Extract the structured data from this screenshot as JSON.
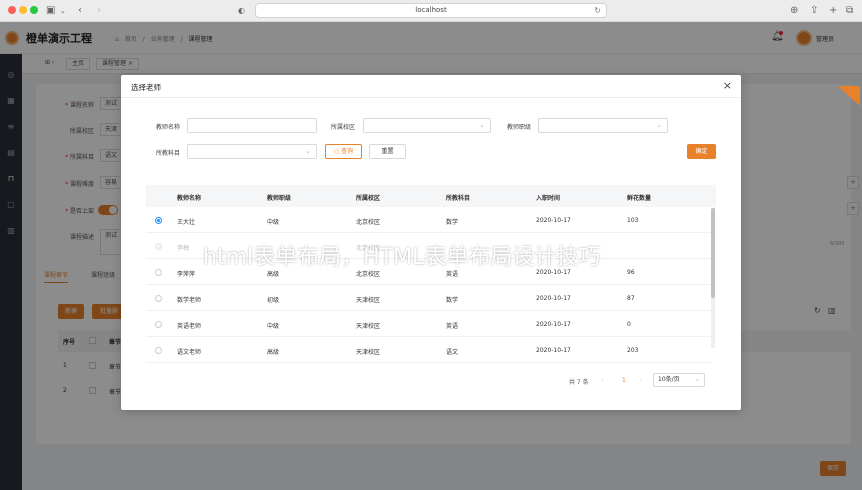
{
  "browser": {
    "url": "localhost"
  },
  "app": {
    "title": "橙单演示工程",
    "breadcrumb": [
      "首页",
      "业务管理",
      "课程管理"
    ],
    "separator": "/",
    "user": "管理员"
  },
  "tabs": [
    {
      "label": "主页"
    },
    {
      "label": "课程管理"
    }
  ],
  "form": {
    "fields": [
      {
        "label": "课程名称",
        "required": true,
        "value": "测试"
      },
      {
        "label": "所属校区",
        "required": false,
        "value": "天津"
      },
      {
        "label": "所属科目",
        "required": true,
        "value": "语文"
      },
      {
        "label": "课程难度",
        "required": true,
        "value": "容易"
      },
      {
        "label": "是否上架",
        "required": true,
        "value": ""
      },
      {
        "label": "课程描述",
        "required": false,
        "value": "测试"
      }
    ],
    "char_count": "6/300",
    "subtabs": [
      "课程章节",
      "课程班级"
    ],
    "add_button": "新建",
    "batch_button": "批量删",
    "table_head": [
      "序号",
      "章节"
    ],
    "rows": [
      "1",
      "2"
    ],
    "row_prefix": "章节",
    "save_button": "保存"
  },
  "modal": {
    "title": "选择老师",
    "filters": {
      "name_label": "教师名称",
      "school_label": "所属校区",
      "level_label": "教师职级",
      "subject_label": "所教科目"
    },
    "query_button": "查询",
    "reset_button": "重置",
    "confirm_button": "确定",
    "columns": [
      "教师名称",
      "教师职级",
      "所属校区",
      "所教科目",
      "入职时间",
      "鲜花数量"
    ],
    "rows": [
      {
        "name": "王大壮",
        "level": "中级",
        "school": "北京校区",
        "subject": "数学",
        "date": "2020-10-17",
        "flowers": "103",
        "checked": true,
        "disabled": false
      },
      {
        "name": "李梅",
        "level": "",
        "school": "北京校区",
        "subject": "",
        "date": "",
        "flowers": "",
        "checked": false,
        "disabled": true
      },
      {
        "name": "李萍萍",
        "level": "高级",
        "school": "北京校区",
        "subject": "英语",
        "date": "2020-10-17",
        "flowers": "96",
        "checked": false,
        "disabled": false
      },
      {
        "name": "数学老师",
        "level": "初级",
        "school": "天津校区",
        "subject": "数学",
        "date": "2020-10-17",
        "flowers": "87",
        "checked": false,
        "disabled": false
      },
      {
        "name": "英语老师",
        "level": "中级",
        "school": "天津校区",
        "subject": "英语",
        "date": "2020-10-17",
        "flowers": "0",
        "checked": false,
        "disabled": false
      },
      {
        "name": "语文老师",
        "level": "高级",
        "school": "天津校区",
        "subject": "语文",
        "date": "2020-10-17",
        "flowers": "203",
        "checked": false,
        "disabled": false
      }
    ],
    "pagination": {
      "total": "共 7 条",
      "current": "1",
      "page_size": "10条/页"
    }
  },
  "watermark": "html表单布局，HTML表单布局设计技巧",
  "colors": {
    "accent": "#e8822a",
    "sidebar": "#2b2f3a",
    "radio": "#1890ff"
  }
}
